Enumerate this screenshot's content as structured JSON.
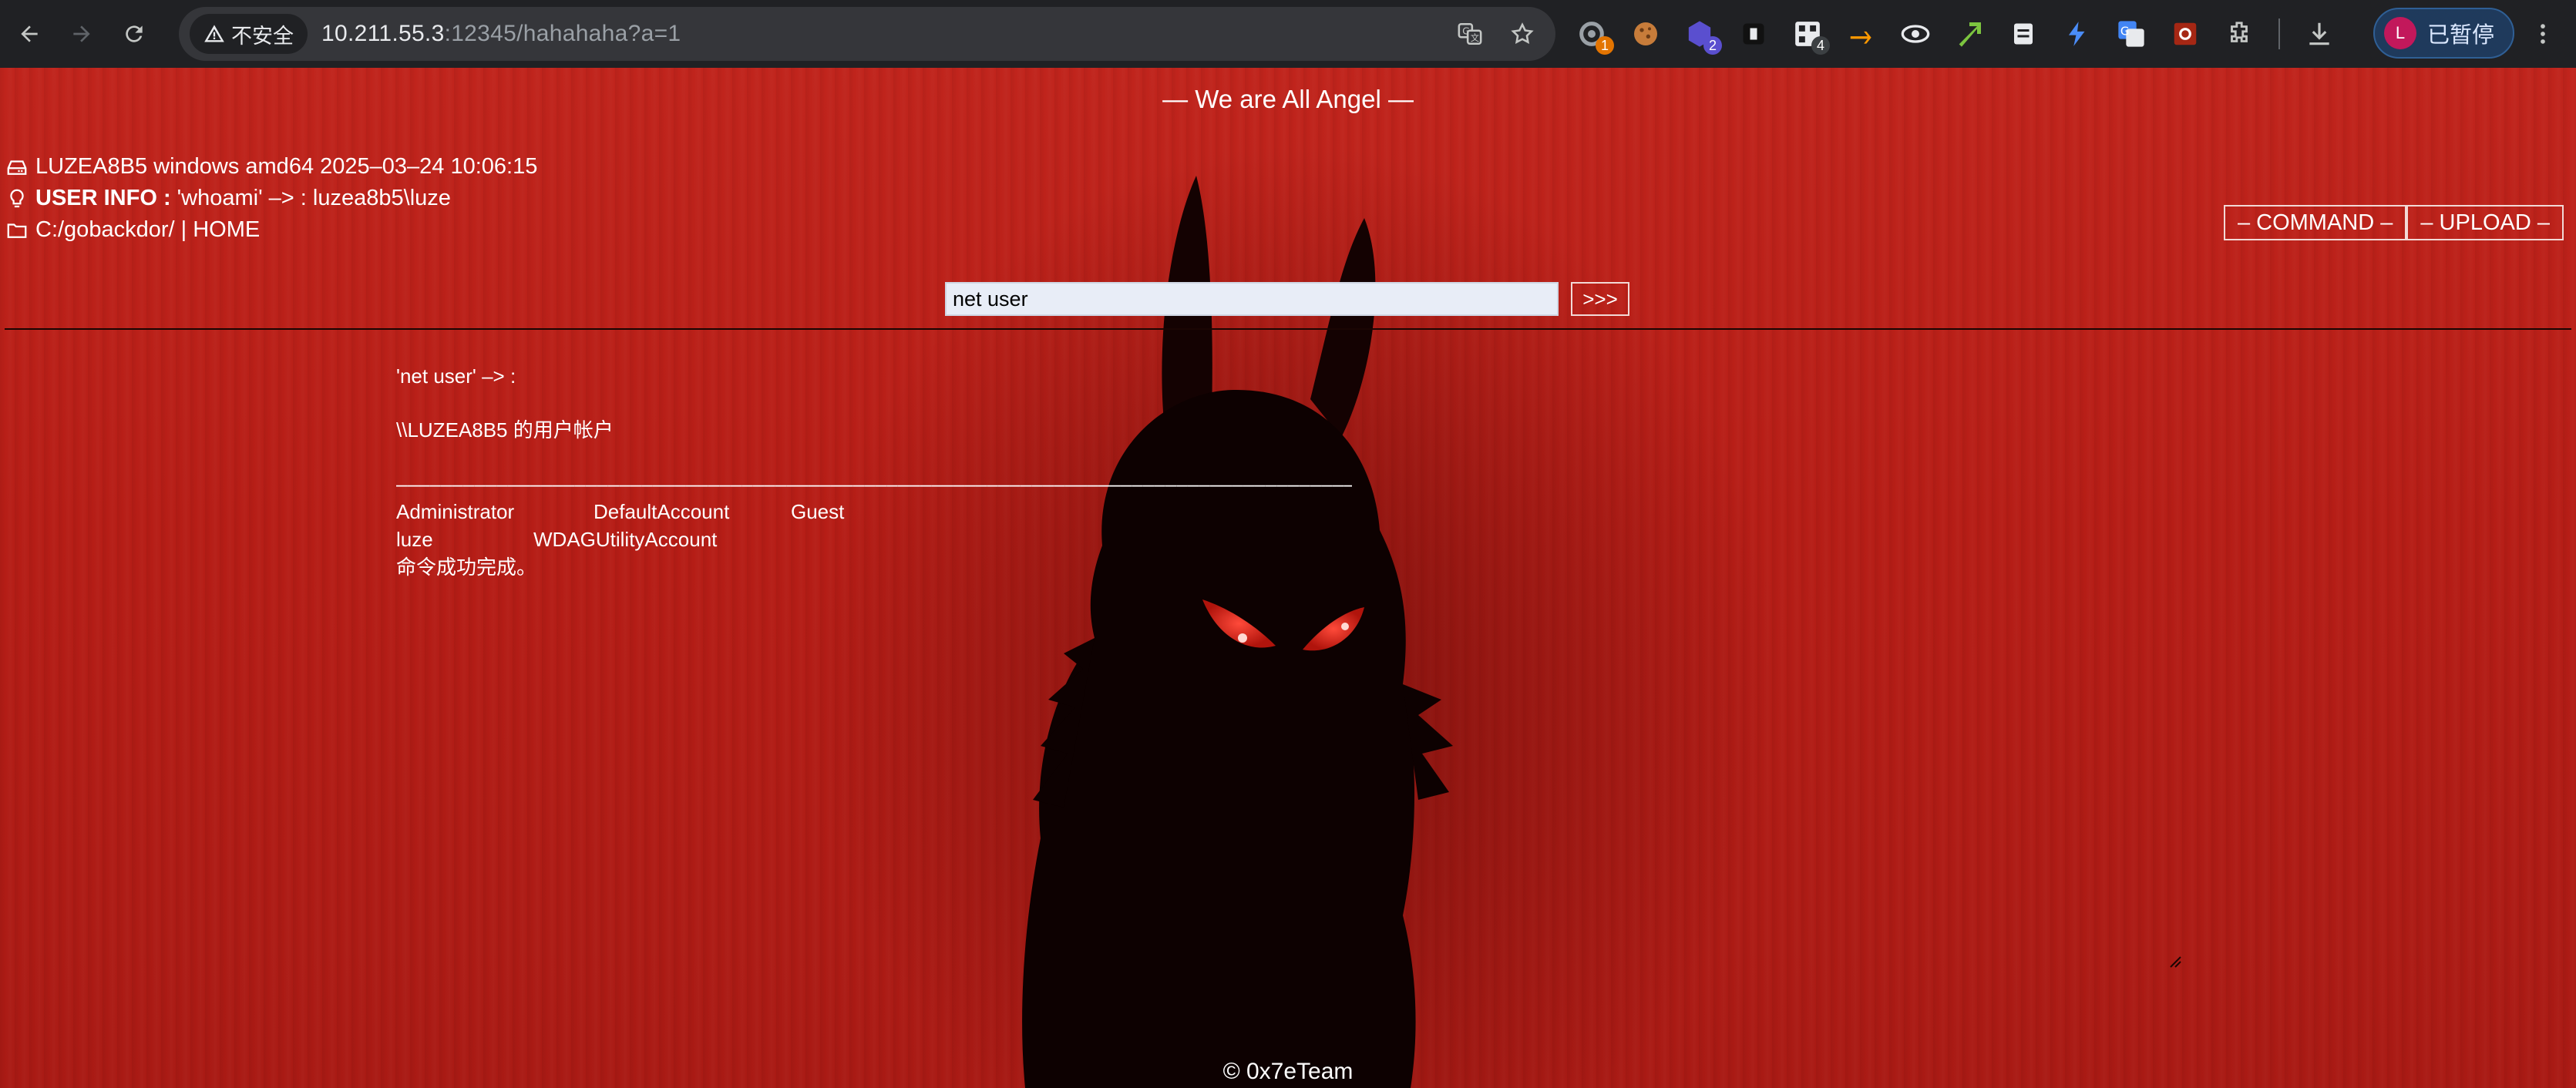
{
  "browser": {
    "security_label": "不安全",
    "url_host": "10.211.55.3",
    "url_rest": ":12345/hahahaha?a=1",
    "extension_badges": [
      "1",
      "2",
      "4"
    ],
    "profile_initial": "L",
    "profile_label": "已暂停"
  },
  "page": {
    "banner": "— We are All Angel —",
    "system_info": "LUZEA8B5 windows amd64 2025–03–24 10:06:15",
    "user_info_label": "USER INFO :",
    "user_info_value": "'whoami' –> : luzea8b5\\luze",
    "path_info": "C:/gobackdor/ | HOME",
    "tabs": [
      "– COMMAND –",
      "– UPLOAD –"
    ],
    "command_value": "net user",
    "run_label": ">>>",
    "output": {
      "echo": "'net user' –> :",
      "header": "\\\\LUZEA8B5 的用户帐户",
      "rule": "––––––––––––––––––––––––––––––––––––––––––––––––––––––––––––––––––––––––––––––––––––––––––––––––––––––––––––––––––––––––––",
      "rows": [
        [
          "Administrator",
          "DefaultAccount",
          "Guest"
        ],
        [
          "luze",
          "WDAGUtilityAccount",
          ""
        ]
      ],
      "footer": "命令成功完成。"
    },
    "copyright": "© 0x7eTeam"
  }
}
